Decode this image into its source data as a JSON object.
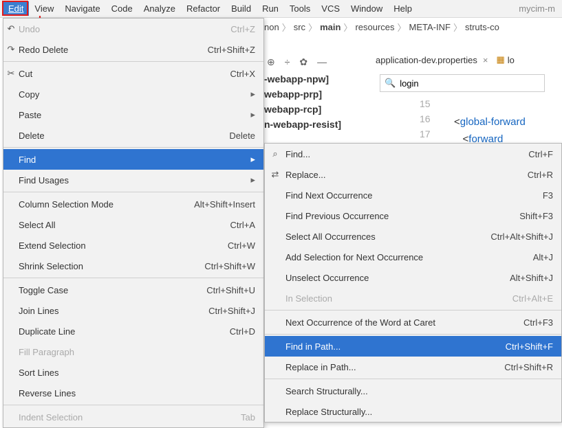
{
  "menubar": {
    "items": [
      {
        "label": "Edit",
        "accel": "E"
      },
      {
        "label": "View",
        "accel": "V"
      },
      {
        "label": "Navigate",
        "accel": "N"
      },
      {
        "label": "Code",
        "accel": "C"
      },
      {
        "label": "Analyze",
        "accel": "z"
      },
      {
        "label": "Refactor",
        "accel": "R"
      },
      {
        "label": "Build",
        "accel": "B"
      },
      {
        "label": "Run",
        "accel": "u"
      },
      {
        "label": "Tools",
        "accel": "T"
      },
      {
        "label": "VCS",
        "accel": "S"
      },
      {
        "label": "Window",
        "accel": "W"
      },
      {
        "label": "Help",
        "accel": "H"
      }
    ],
    "extra": "mycim-m"
  },
  "edit_menu": [
    {
      "icon": "↶",
      "label": "Undo",
      "shortcut": "Ctrl+Z",
      "disabled": true
    },
    {
      "icon": "↷",
      "label": "Redo Delete",
      "shortcut": "Ctrl+Shift+Z"
    },
    {
      "sep": true
    },
    {
      "icon": "✂",
      "label": "Cut",
      "shortcut": "Ctrl+X"
    },
    {
      "label": "Copy",
      "shortcut": "",
      "submenu": true
    },
    {
      "label": "Paste",
      "shortcut": "",
      "submenu": true
    },
    {
      "label": "Delete",
      "shortcut": "Delete"
    },
    {
      "sep": true
    },
    {
      "label": "Find",
      "shortcut": "",
      "submenu": true,
      "highlight": true
    },
    {
      "label": "Find Usages",
      "shortcut": "",
      "submenu": true
    },
    {
      "sep": true
    },
    {
      "label": "Column Selection Mode",
      "shortcut": "Alt+Shift+Insert"
    },
    {
      "label": "Select All",
      "shortcut": "Ctrl+A"
    },
    {
      "label": "Extend Selection",
      "shortcut": "Ctrl+W"
    },
    {
      "label": "Shrink Selection",
      "shortcut": "Ctrl+Shift+W"
    },
    {
      "sep": true
    },
    {
      "label": "Toggle Case",
      "shortcut": "Ctrl+Shift+U"
    },
    {
      "label": "Join Lines",
      "shortcut": "Ctrl+Shift+J"
    },
    {
      "label": "Duplicate Line",
      "shortcut": "Ctrl+D"
    },
    {
      "label": "Fill Paragraph",
      "shortcut": "",
      "disabled": true
    },
    {
      "label": "Sort Lines",
      "shortcut": ""
    },
    {
      "label": "Reverse Lines",
      "shortcut": ""
    },
    {
      "sep": true
    },
    {
      "label": "Indent Selection",
      "shortcut": "Tab",
      "disabled": true
    }
  ],
  "find_menu": [
    {
      "icon": "⌕",
      "label": "Find...",
      "shortcut": "Ctrl+F"
    },
    {
      "icon": "⇄",
      "label": "Replace...",
      "shortcut": "Ctrl+R"
    },
    {
      "label": "Find Next Occurrence",
      "shortcut": "F3"
    },
    {
      "label": "Find Previous Occurrence",
      "shortcut": "Shift+F3"
    },
    {
      "label": "Select All Occurrences",
      "shortcut": "Ctrl+Alt+Shift+J"
    },
    {
      "label": "Add Selection for Next Occurrence",
      "shortcut": "Alt+J"
    },
    {
      "label": "Unselect Occurrence",
      "shortcut": "Alt+Shift+J"
    },
    {
      "label": "In Selection",
      "shortcut": "Ctrl+Alt+E",
      "disabled": true
    },
    {
      "sep": true
    },
    {
      "label": "Next Occurrence of the Word at Caret",
      "shortcut": "Ctrl+F3"
    },
    {
      "sep": true
    },
    {
      "label": "Find in Path...",
      "shortcut": "Ctrl+Shift+F",
      "highlight": true
    },
    {
      "label": "Replace in Path...",
      "shortcut": "Ctrl+Shift+R"
    },
    {
      "sep": true
    },
    {
      "label": "Search Structurally...",
      "shortcut": ""
    },
    {
      "label": "Replace Structurally...",
      "shortcut": ""
    }
  ],
  "breadcrumb": [
    "non",
    "src",
    "main",
    "resources",
    "META-INF",
    "struts-co"
  ],
  "breadcrumb_bold": "main",
  "tabs": [
    {
      "label": "application-dev.properties"
    },
    {
      "label": "lo"
    }
  ],
  "project_items": [
    "-webapp-npw]",
    "webapp-prp]",
    "webapp-rcp]",
    "n-webapp-resist]"
  ],
  "search": {
    "value": "login"
  },
  "gutter": [
    "15",
    "16",
    "17"
  ],
  "code": {
    "line1a": "<",
    "line1b": "global-forward",
    "line2a": "<",
    "line2b": "forward"
  }
}
